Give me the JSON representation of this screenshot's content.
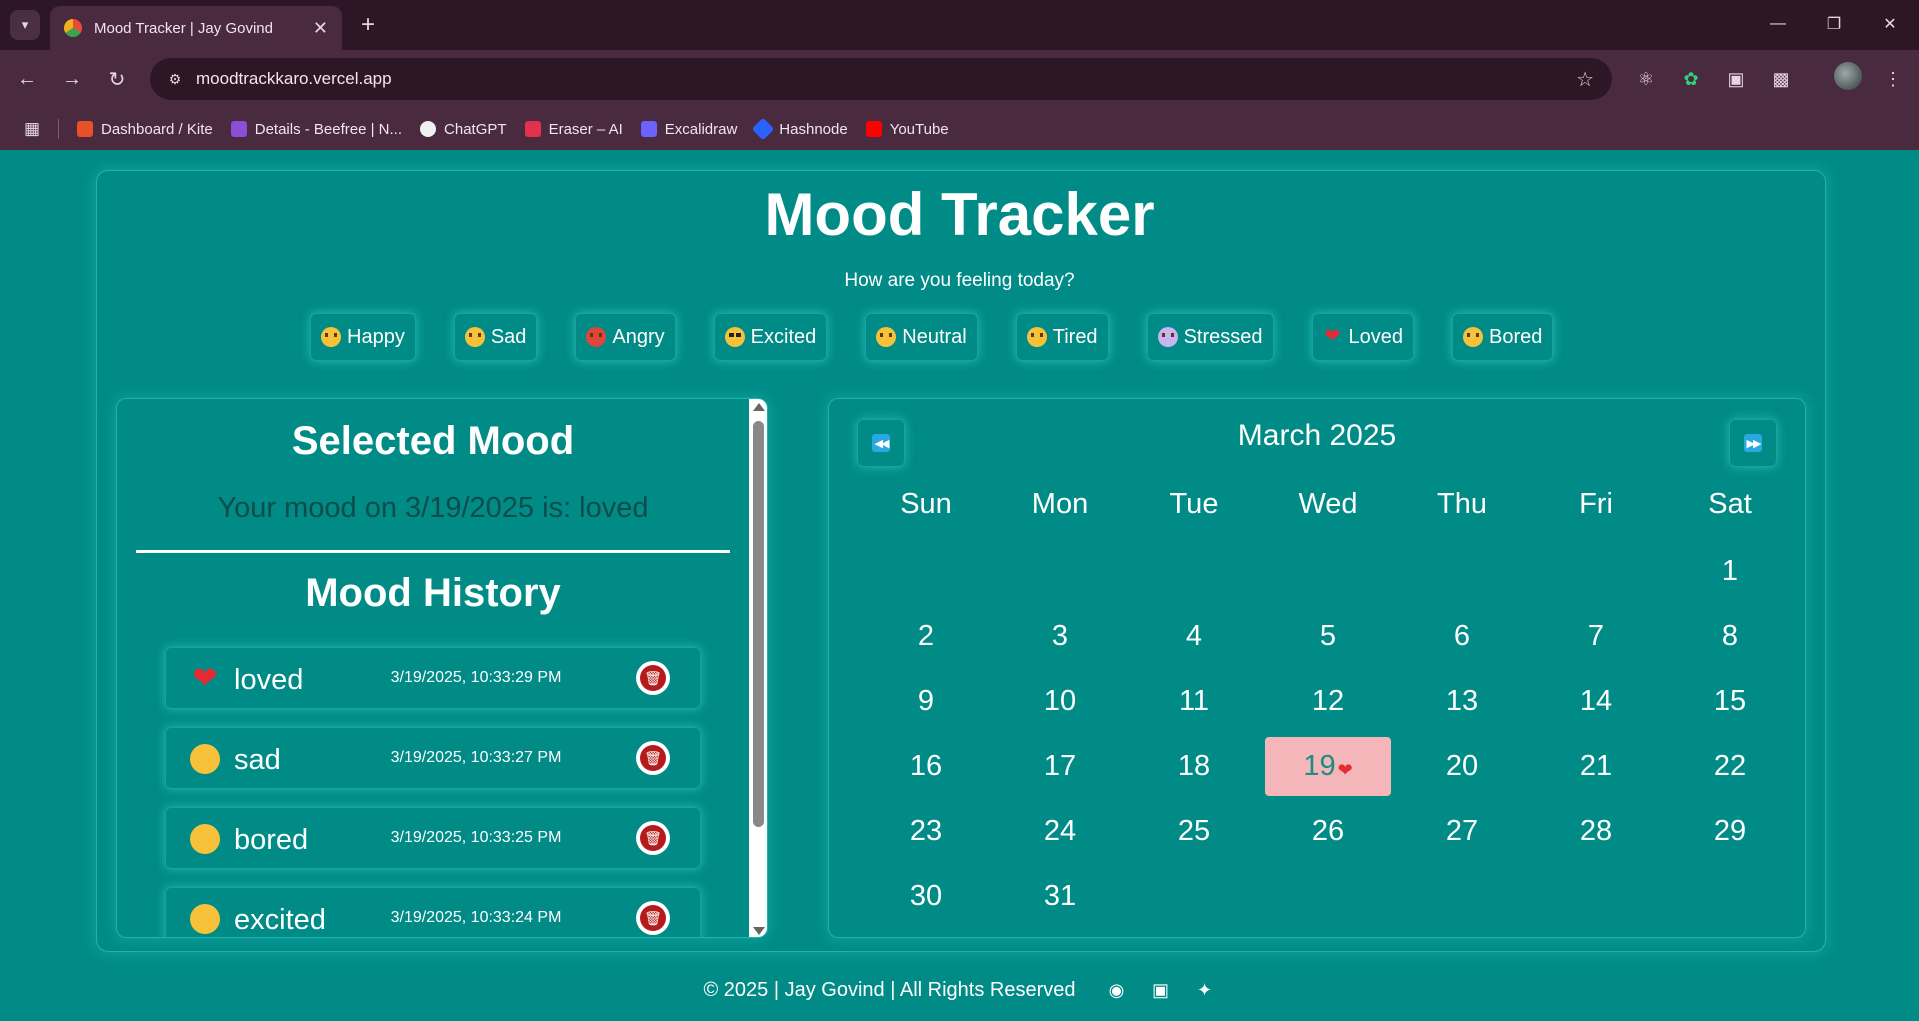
{
  "browser": {
    "tab_title": "Mood Tracker | Jay Govind",
    "url": "moodtrackkaro.vercel.app",
    "bookmarks": [
      {
        "label": "Dashboard / Kite",
        "color": "#e8502a"
      },
      {
        "label": "Details - Beefree | N...",
        "color": "#8a4fd6"
      },
      {
        "label": "ChatGPT",
        "color": "#f0f0f0"
      },
      {
        "label": "Eraser – AI",
        "color": "#e2314c"
      },
      {
        "label": "Excalidraw",
        "color": "#6c63ff"
      },
      {
        "label": "Hashnode",
        "color": "#2962ff"
      },
      {
        "label": "YouTube",
        "color": "#ff0000"
      }
    ]
  },
  "app": {
    "title": "Mood Tracker",
    "subtitle": "How are you feeling today?",
    "moods": [
      "Happy",
      "Sad",
      "Angry",
      "Excited",
      "Neutral",
      "Tired",
      "Stressed",
      "Loved",
      "Bored"
    ]
  },
  "selected": {
    "title": "Selected Mood",
    "text": "Your mood on 3/19/2025 is: loved"
  },
  "history": {
    "title": "Mood History",
    "items": [
      {
        "mood": "loved",
        "time": "3/19/2025, 10:33:29 PM"
      },
      {
        "mood": "sad",
        "time": "3/19/2025, 10:33:27 PM"
      },
      {
        "mood": "bored",
        "time": "3/19/2025, 10:33:25 PM"
      },
      {
        "mood": "excited",
        "time": "3/19/2025, 10:33:24 PM"
      }
    ]
  },
  "calendar": {
    "month": "March 2025",
    "days_of_week": [
      "Sun",
      "Mon",
      "Tue",
      "Wed",
      "Thu",
      "Fri",
      "Sat"
    ],
    "days": [
      "1",
      "2",
      "3",
      "4",
      "5",
      "6",
      "7",
      "8",
      "9",
      "10",
      "11",
      "12",
      "13",
      "14",
      "15",
      "16",
      "17",
      "18",
      "19",
      "20",
      "21",
      "22",
      "23",
      "24",
      "25",
      "26",
      "27",
      "28",
      "29",
      "30",
      "31"
    ],
    "selected_day": "19"
  },
  "footer": {
    "text": "© 2025 | Jay Govind | All Rights Reserved"
  },
  "colors": {
    "background": "#008b87",
    "selected_day": "#f4b6b8",
    "delete": "#b51b1b"
  }
}
